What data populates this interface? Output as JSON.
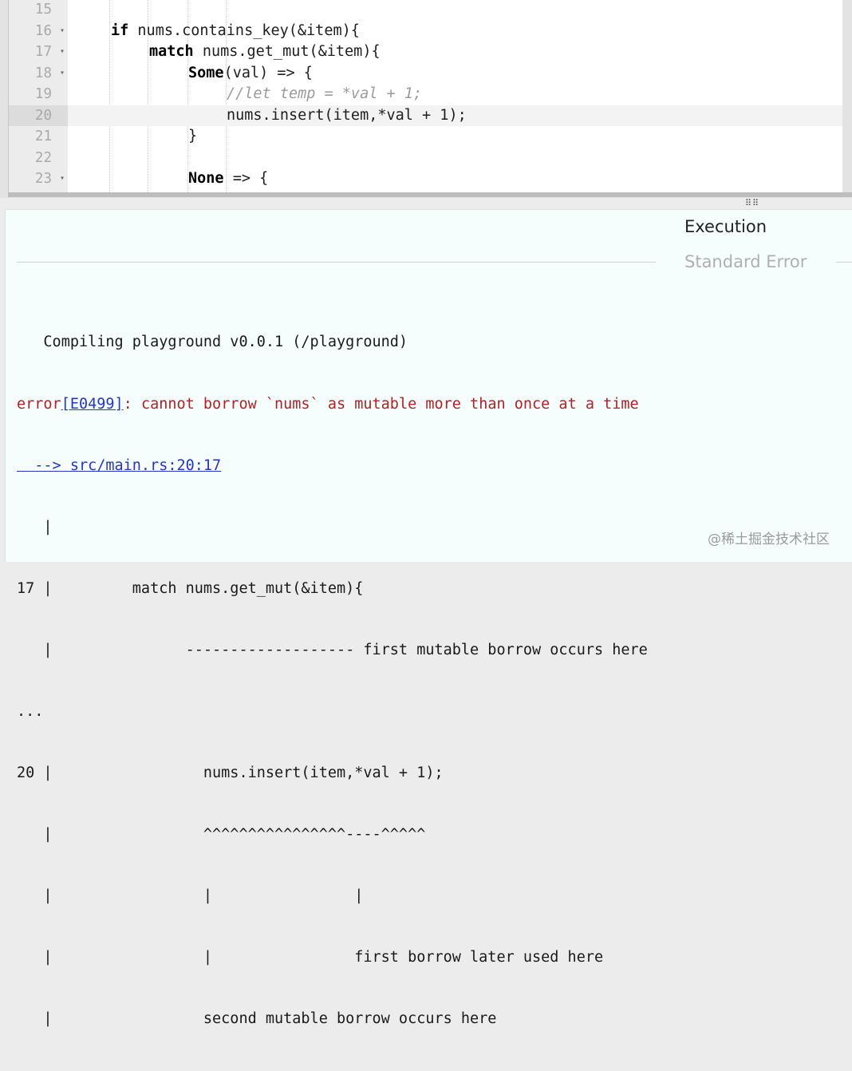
{
  "editor": {
    "active_line": "20",
    "lines": [
      {
        "num": "15",
        "fold": "",
        "code": ""
      },
      {
        "num": "16",
        "fold": "▾",
        "code": "if nums.contains_key(&item){"
      },
      {
        "num": "17",
        "fold": "▾",
        "code": "match nums.get_mut(&item){"
      },
      {
        "num": "18",
        "fold": "▾",
        "code": "Some(val) => {"
      },
      {
        "num": "19",
        "fold": "",
        "code": "//let temp = *val + 1;"
      },
      {
        "num": "20",
        "fold": "",
        "code": "nums.insert(item,*val + 1);"
      },
      {
        "num": "21",
        "fold": "",
        "code": "}"
      },
      {
        "num": "22",
        "fold": "",
        "code": ""
      },
      {
        "num": "23",
        "fold": "▾",
        "code": "None => {"
      }
    ]
  },
  "splitter": {
    "glyph": "⠿⠿"
  },
  "output": {
    "tabs": {
      "execution": "Execution",
      "standard_error": "Standard Error"
    },
    "console": {
      "compiling": "   Compiling playground v0.0.1 (/playground)",
      "error_prefix": "error",
      "error_code": "[E0499]",
      "error_message": ": cannot borrow `nums` as mutable more than once at a time",
      "location_arrow": "  --> ",
      "location": "src/main.rs:20:17",
      "pipe1": "   |",
      "line17": "17 |         match nums.get_mut(&item){",
      "line17_marker": "   |               ------------------- first mutable borrow occurs here",
      "ellipsis": "...",
      "line20": "20 |                 nums.insert(item,*val + 1);",
      "line20_marker": "   |                 ^^^^^^^^^^^^^^^^----^^^^^",
      "pipe_bars": "   |                 |                |",
      "later_used": "   |                 |                first borrow later used here",
      "second_borrow": "   |                 second mutable borrow occurs here"
    }
  },
  "watermark": "@稀土掘金技术社区"
}
